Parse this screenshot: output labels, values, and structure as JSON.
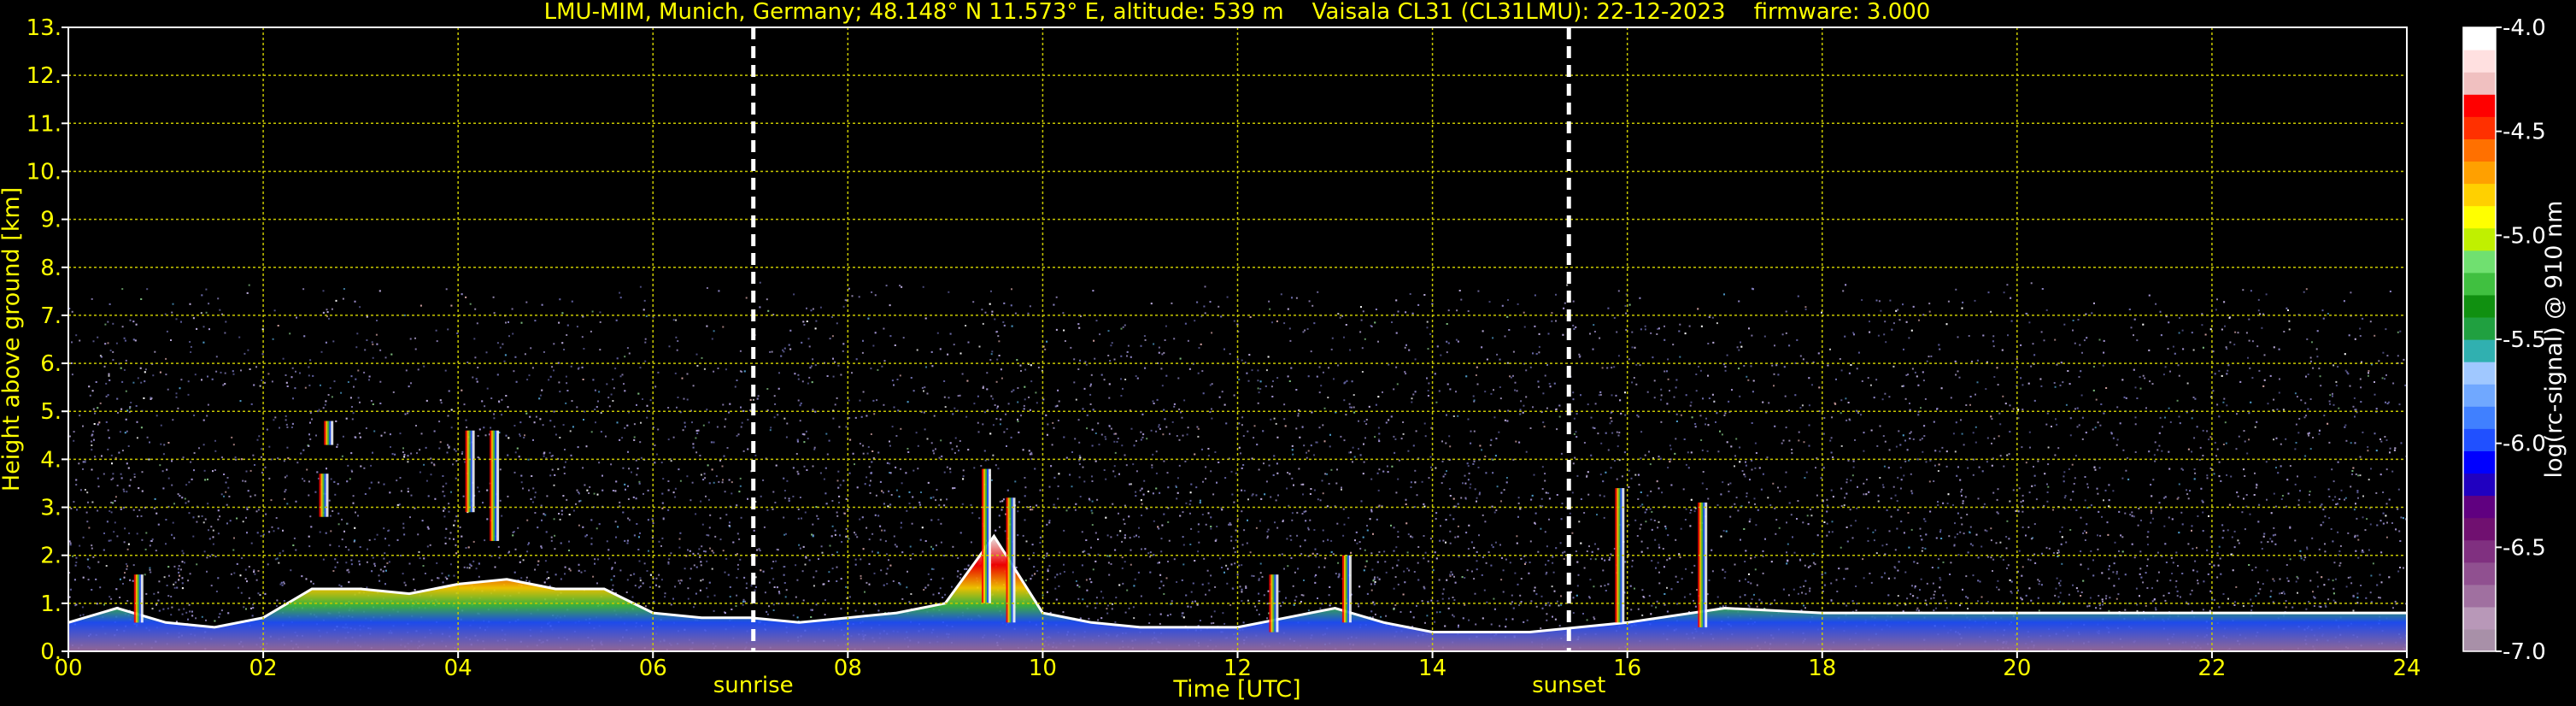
{
  "chart_data": {
    "type": "heatmap",
    "title": "LMU-MIM, Munich, Germany; 48.148° N 11.573° E, altitude: 539 m    Vaisala CL31 (CL31LMU): 22-12-2023    firmware: 3.000",
    "xlabel": "Time [UTC]",
    "ylabel": "Height above ground [km]",
    "x_ticks": [
      "00",
      "02",
      "04",
      "06",
      "08",
      "10",
      "12",
      "14",
      "16",
      "18",
      "20",
      "22",
      "24"
    ],
    "y_ticks": [
      "0.",
      "1.",
      "2.",
      "3.",
      "4.",
      "5.",
      "6.",
      "7.",
      "8.",
      "9.",
      "10.",
      "11.",
      "12.",
      "13."
    ],
    "xlim": [
      0,
      24
    ],
    "ylim": [
      0,
      13
    ],
    "grid": true,
    "colorbar": {
      "label": "log(rc-signal) @ 910 nm",
      "ticks": [
        "-4.0",
        "-4.5",
        "-5.0",
        "-5.5",
        "-6.0",
        "-6.5",
        "-7.0"
      ],
      "range": [
        -7.0,
        -4.0
      ],
      "colors": [
        "#a890a8",
        "#b898b8",
        "#a070a0",
        "#905090",
        "#803080",
        "#701070",
        "#600080",
        "#2000c0",
        "#0000ff",
        "#2050ff",
        "#4080ff",
        "#70a8ff",
        "#a0c8ff",
        "#30b0b0",
        "#20a040",
        "#109010",
        "#40c040",
        "#70e070",
        "#c0f000",
        "#ffff00",
        "#ffd000",
        "#ffa000",
        "#ff7000",
        "#ff3000",
        "#ff0000",
        "#f0c0c0",
        "#ffe0e0",
        "#ffffff"
      ]
    },
    "markers": [
      {
        "label": "sunrise",
        "x": 7.03
      },
      {
        "label": "sunset",
        "x": 15.4
      }
    ],
    "noise_top_km": 7.7,
    "boundary_layer": [
      {
        "t": 0.0,
        "h": 0.6
      },
      {
        "t": 0.5,
        "h": 0.9
      },
      {
        "t": 1.0,
        "h": 0.6
      },
      {
        "t": 1.5,
        "h": 0.5
      },
      {
        "t": 2.0,
        "h": 0.7
      },
      {
        "t": 2.5,
        "h": 1.3
      },
      {
        "t": 3.0,
        "h": 1.3
      },
      {
        "t": 3.5,
        "h": 1.2
      },
      {
        "t": 4.0,
        "h": 1.4
      },
      {
        "t": 4.5,
        "h": 1.5
      },
      {
        "t": 5.0,
        "h": 1.3
      },
      {
        "t": 5.5,
        "h": 1.3
      },
      {
        "t": 6.0,
        "h": 0.8
      },
      {
        "t": 6.5,
        "h": 0.7
      },
      {
        "t": 7.0,
        "h": 0.7
      },
      {
        "t": 7.5,
        "h": 0.6
      },
      {
        "t": 8.0,
        "h": 0.7
      },
      {
        "t": 8.5,
        "h": 0.8
      },
      {
        "t": 9.0,
        "h": 1.0
      },
      {
        "t": 9.5,
        "h": 2.4
      },
      {
        "t": 10.0,
        "h": 0.8
      },
      {
        "t": 10.5,
        "h": 0.6
      },
      {
        "t": 11.0,
        "h": 0.5
      },
      {
        "t": 12.0,
        "h": 0.5
      },
      {
        "t": 13.0,
        "h": 0.9
      },
      {
        "t": 13.5,
        "h": 0.6
      },
      {
        "t": 14.0,
        "h": 0.4
      },
      {
        "t": 15.0,
        "h": 0.4
      },
      {
        "t": 16.0,
        "h": 0.6
      },
      {
        "t": 17.0,
        "h": 0.9
      },
      {
        "t": 18.0,
        "h": 0.8
      },
      {
        "t": 19.0,
        "h": 0.8
      },
      {
        "t": 20.0,
        "h": 0.8
      },
      {
        "t": 21.0,
        "h": 0.8
      },
      {
        "t": 22.0,
        "h": 0.8
      },
      {
        "t": 23.0,
        "h": 0.8
      },
      {
        "t": 24.0,
        "h": 0.8
      }
    ],
    "plumes": [
      {
        "t": 0.7,
        "h0": 0.6,
        "h1": 1.6
      },
      {
        "t": 2.6,
        "h0": 2.8,
        "h1": 3.7
      },
      {
        "t": 2.65,
        "h0": 4.3,
        "h1": 4.8
      },
      {
        "t": 4.1,
        "h0": 2.9,
        "h1": 4.6
      },
      {
        "t": 4.35,
        "h0": 2.3,
        "h1": 4.6
      },
      {
        "t": 9.4,
        "h0": 1.0,
        "h1": 3.8
      },
      {
        "t": 9.65,
        "h0": 0.6,
        "h1": 3.2
      },
      {
        "t": 12.35,
        "h0": 0.4,
        "h1": 1.6
      },
      {
        "t": 13.1,
        "h0": 0.6,
        "h1": 2.0
      },
      {
        "t": 15.9,
        "h0": 0.6,
        "h1": 3.4
      },
      {
        "t": 16.75,
        "h0": 0.5,
        "h1": 3.1
      }
    ]
  }
}
